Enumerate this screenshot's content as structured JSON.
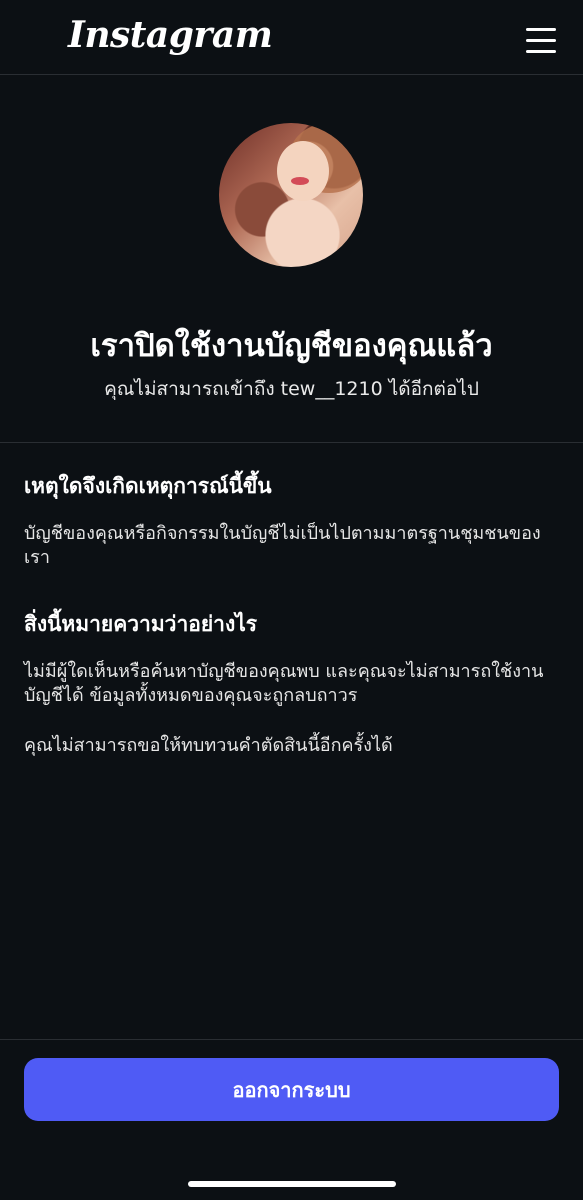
{
  "header": {
    "logo_text": "Instagram",
    "menu_icon": "hamburger-menu-icon"
  },
  "profile": {
    "avatar_icon": "profile-photo"
  },
  "notice": {
    "title": "เราปิดใช้งานบัญชีของคุณแล้ว",
    "subtitle": "คุณไม่สามารถเข้าถึง tew__1210 ได้อีกต่อไป"
  },
  "sections": [
    {
      "heading": "เหตุใดจึงเกิดเหตุการณ์นี้ขึ้น",
      "paragraphs": [
        "บัญชีของคุณหรือกิจกรรมในบัญชีไม่เป็นไปตามมาตรฐานชุมชนของเรา"
      ]
    },
    {
      "heading": "สิ่งนี้หมายความว่าอย่างไร",
      "paragraphs": [
        "ไม่มีผู้ใดเห็นหรือค้นหาบัญชีของคุณพบ และคุณจะไม่สามารถใช้งานบัญชีได้ ข้อมูลทั้งหมดของคุณจะถูกลบถาวร",
        "คุณไม่สามารถขอให้ทบทวนคำตัดสินนี้อีกครั้งได้"
      ]
    }
  ],
  "footer": {
    "logout_label": "ออกจากระบบ"
  },
  "colors": {
    "background": "#0c1014",
    "button": "#4f5bf5",
    "divider": "#2a2e33"
  }
}
